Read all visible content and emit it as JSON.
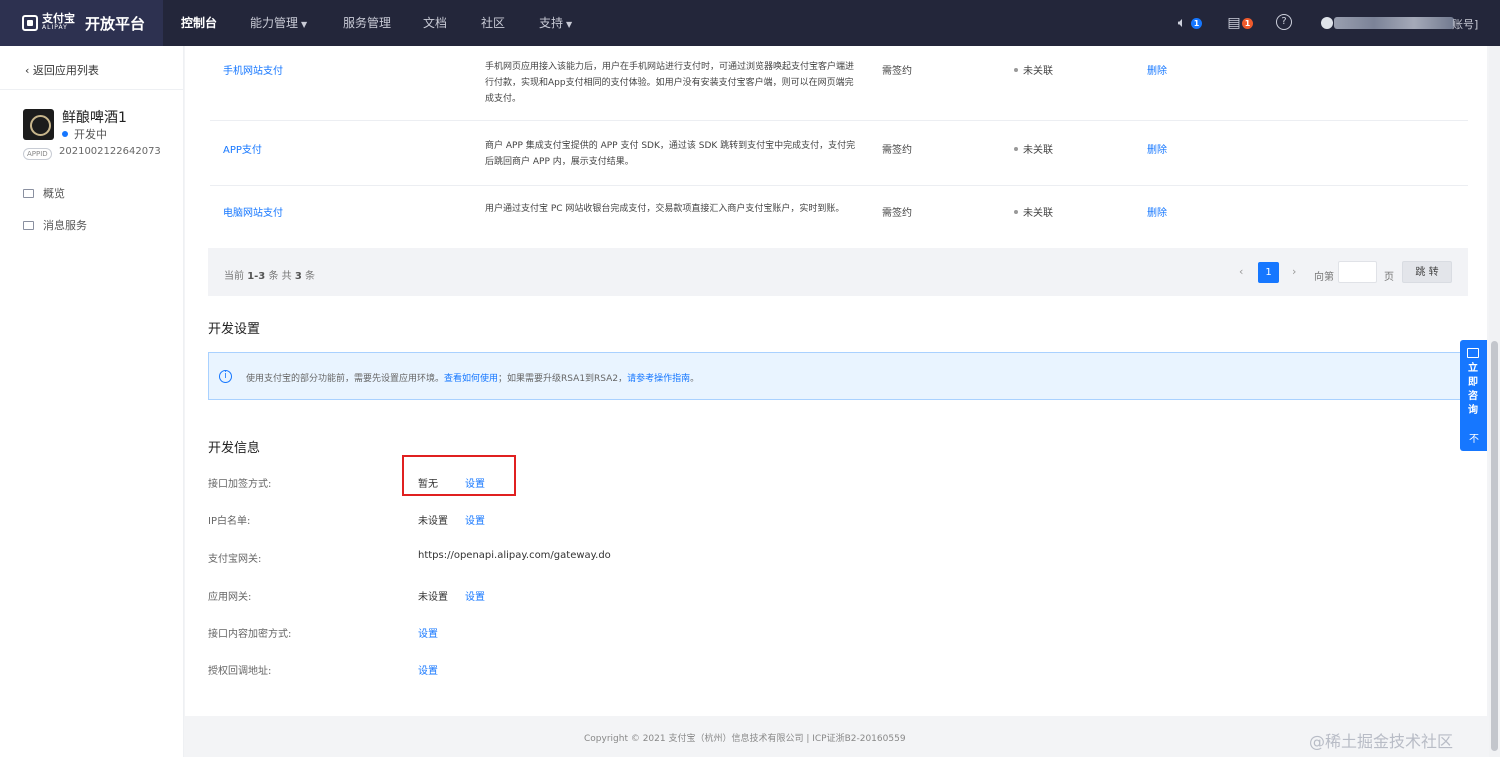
{
  "topbar": {
    "brand_cn": "支付宝",
    "brand_en": "ALIPAY",
    "brand_title": "开放平台",
    "nav": [
      {
        "label": "控制台",
        "active": true
      },
      {
        "label": "能力管理",
        "dropdown": true
      },
      {
        "label": "服务管理"
      },
      {
        "label": "文档"
      },
      {
        "label": "社区"
      },
      {
        "label": "支持",
        "dropdown": true
      }
    ],
    "notify_count": "1",
    "todo_count": "1",
    "account_suffix": "账号]",
    "icons": [
      "speaker-icon",
      "document-icon",
      "help-icon"
    ]
  },
  "sidebar": {
    "back_label": "返回应用列表",
    "app_name": "鲜酿啤酒1",
    "app_status": "开发中",
    "appid_tag": "APPID",
    "appid_value": "2021002122642073",
    "items": [
      {
        "label": "概览",
        "icon": "overview-icon"
      },
      {
        "label": "消息服务",
        "icon": "message-icon"
      }
    ]
  },
  "abilities": {
    "rows": [
      {
        "name": "手机网站支付",
        "desc": "手机网页应用接入该能力后，用户在手机网站进行支付时，可通过浏览器唤起支付宝客户端进行付款，实现和App支付相同的支付体验。如用户没有安装支付宝客户端，则可以在网页端完成支付。",
        "sign": "需签约",
        "assoc": "未关联",
        "action": "删除"
      },
      {
        "name": "APP支付",
        "desc": "商户 APP 集成支付宝提供的 APP 支付 SDK，通过该 SDK 跳转到支付宝中完成支付，支付完后跳回商户 APP 内，展示支付结果。",
        "sign": "需签约",
        "assoc": "未关联",
        "action": "删除"
      },
      {
        "name": "电脑网站支付",
        "desc": "用户通过支付宝 PC 网站收银台完成支付，交易款项直接汇入商户支付宝账户，实时到账。",
        "sign": "需签约",
        "assoc": "未关联",
        "action": "删除"
      }
    ],
    "pager": {
      "info_prefix": "当前",
      "range": "1-3",
      "info_mid": "条 共",
      "total": "3",
      "info_suffix": "条",
      "current_page": "1",
      "goto_label": "向第",
      "page_unit": "页",
      "jump_label": "跳 转",
      "prev": "‹",
      "next": "›"
    }
  },
  "dev_settings": {
    "title": "开发设置",
    "notice_pre": "使用支付宝的部分功能前，需要先设置应用环境。",
    "notice_link1": "查看如何使用",
    "notice_mid": "；如果需要升级RSA1到RSA2，",
    "notice_link2": "请参考操作指南",
    "notice_end": "。"
  },
  "dev_info": {
    "title": "开发信息",
    "rows": [
      {
        "label": "接口加签方式:",
        "value": "暂无",
        "link": "设置"
      },
      {
        "label": "IP白名单:",
        "value": "未设置",
        "link": "设置"
      },
      {
        "label": "支付宝网关:",
        "value": "https://openapi.alipay.com/gateway.do",
        "link": ""
      },
      {
        "label": "应用网关:",
        "value": "未设置",
        "link": "设置"
      },
      {
        "label": "接口内容加密方式:",
        "value": "",
        "link": "设置"
      },
      {
        "label": "授权回调地址:",
        "value": "",
        "link": "设置"
      }
    ]
  },
  "footer": {
    "copyright": "Copyright © 2021 支付宝（杭州）信息技术有限公司 | ICP证浙B2-20160559"
  },
  "watermark": "@稀土掘金技术社区",
  "consult": {
    "label": "立即咨询",
    "close": "不"
  }
}
